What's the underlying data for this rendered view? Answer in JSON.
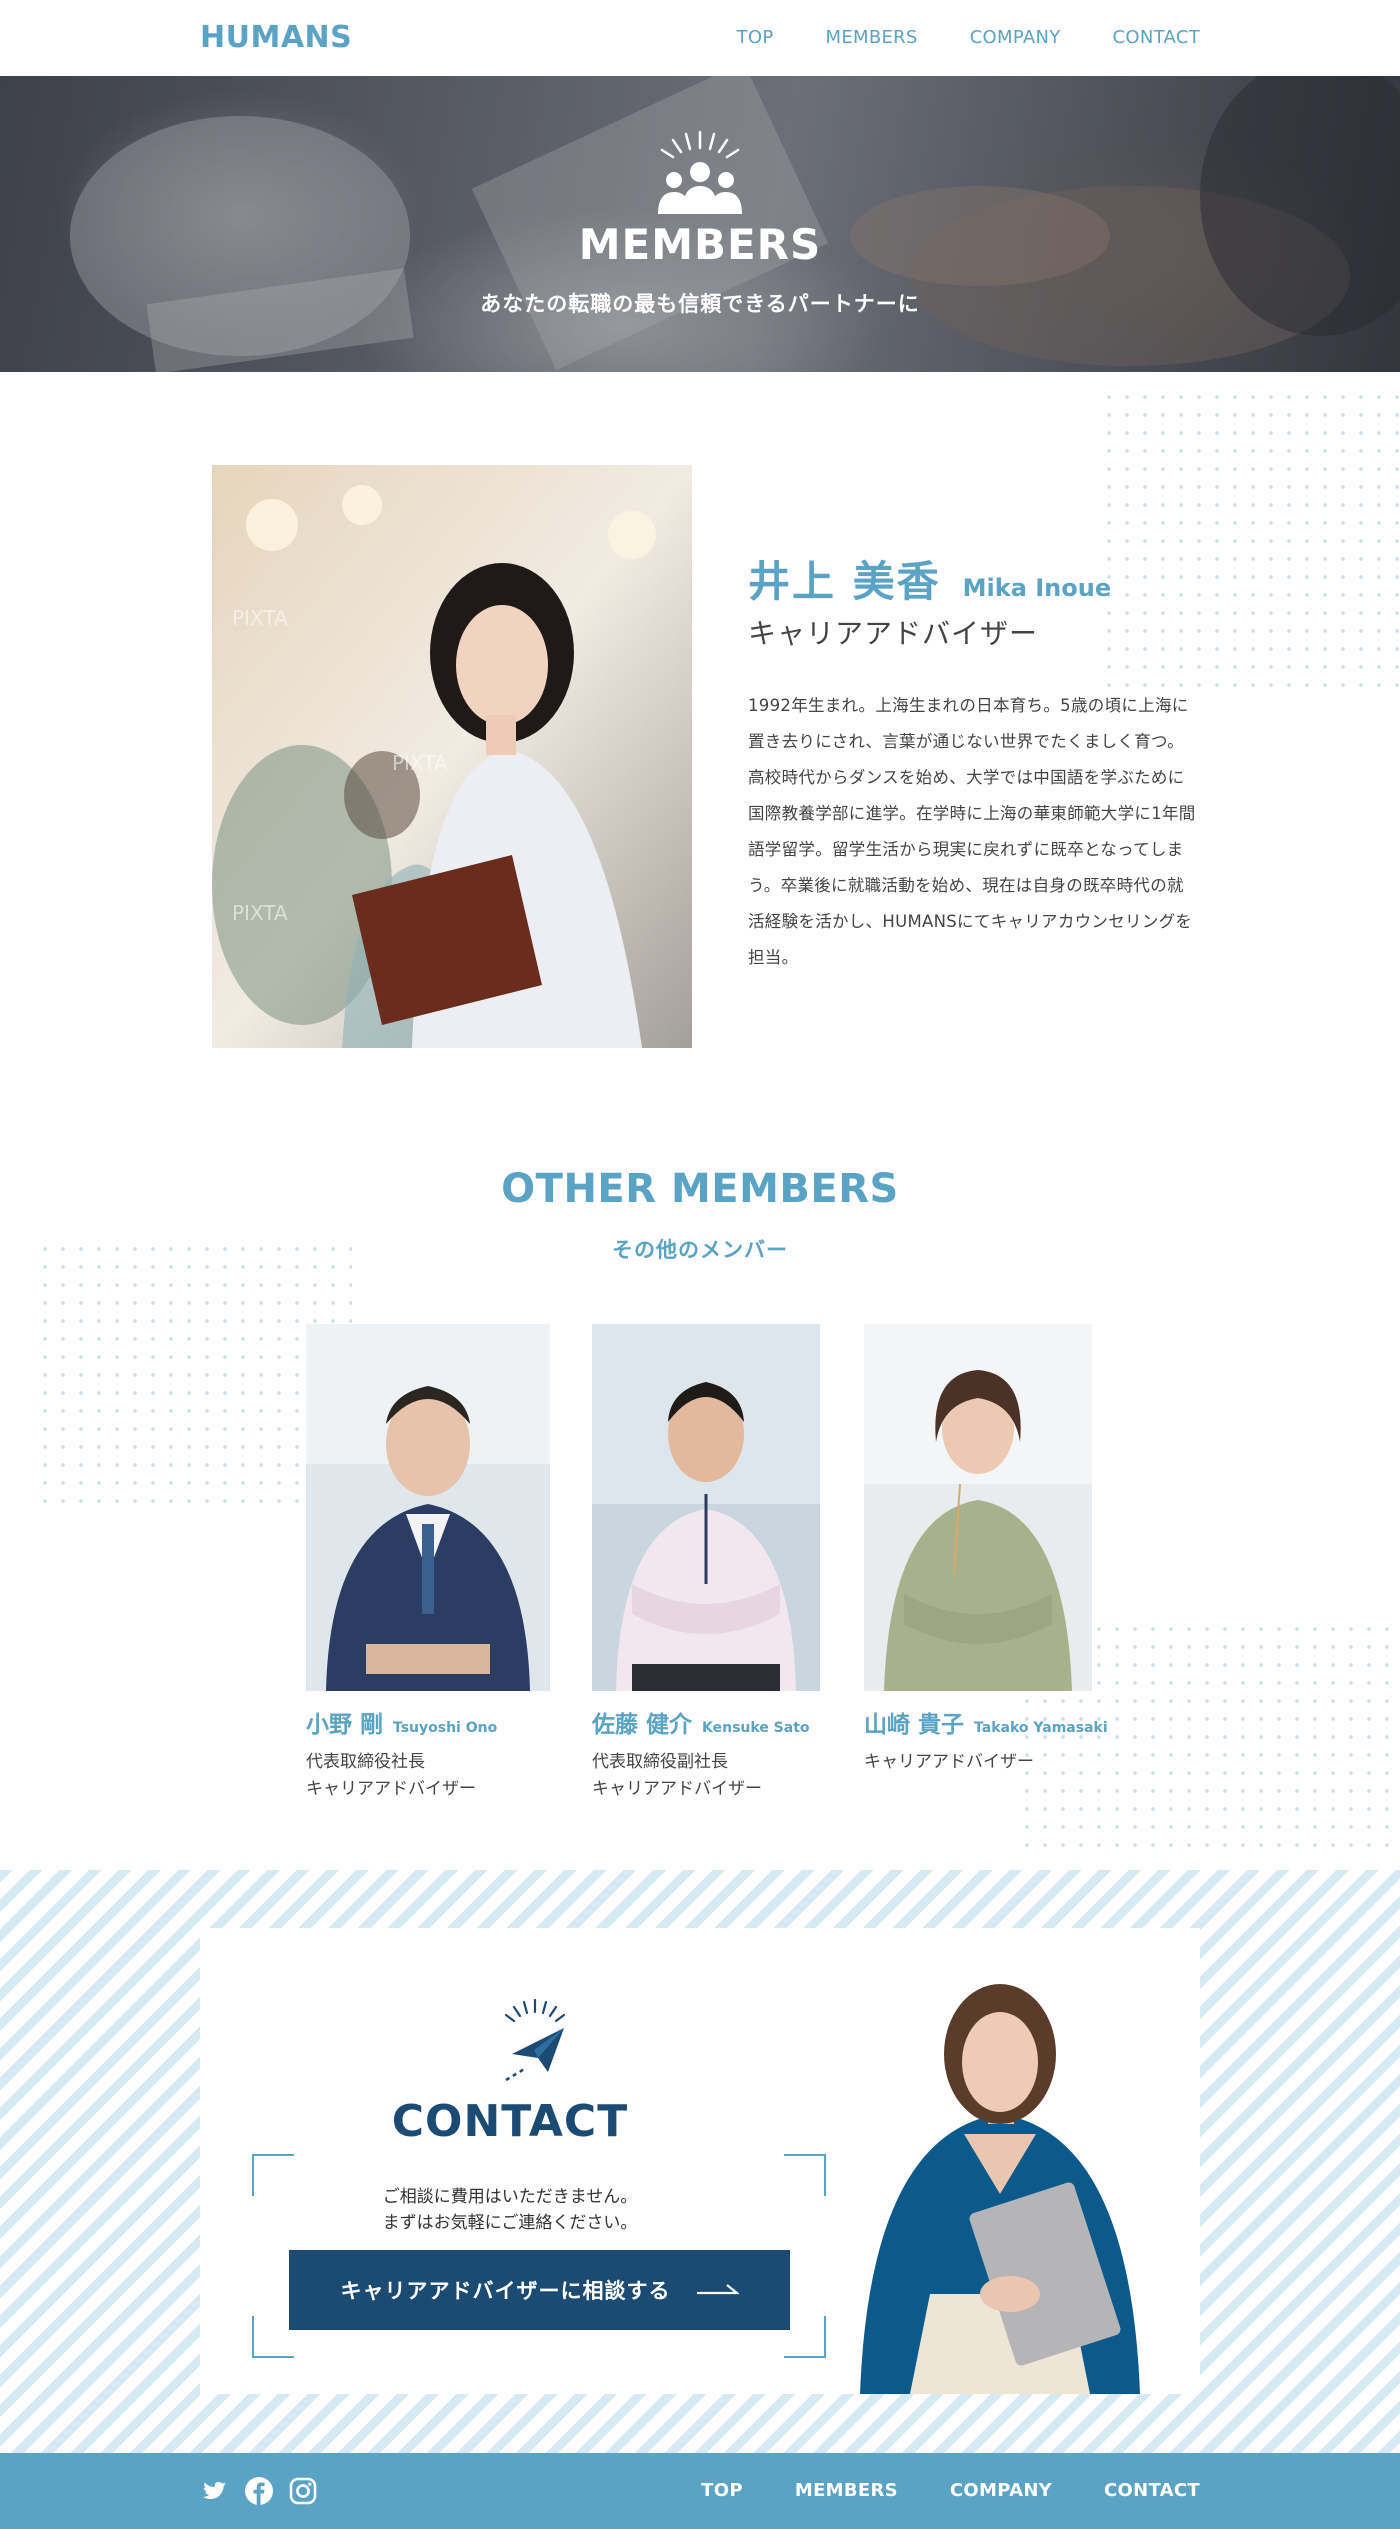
{
  "header": {
    "logo": "HUMANS",
    "nav": [
      "TOP",
      "MEMBERS",
      "COMPANY",
      "CONTACT"
    ]
  },
  "hero": {
    "icon": "team-icon",
    "title": "MEMBERS",
    "subtitle": "あなたの転職の最も信頼できるパートナーに"
  },
  "featured": {
    "name_jp": "井上 美香",
    "name_en": "Mika Inoue",
    "role": "キャリアアドバイザー",
    "bio": "1992年生まれ。上海生まれの日本育ち。5歳の頃に上海に置き去りにされ、言葉が通じない世界でたくましく育つ。高校時代からダンスを始め、大学では中国語を学ぶために国際教養学部に進学。在学時に上海の華東師範大学に1年間語学留学。留学生活から現実に戻れずに既卒となってしまう。卒業後に就職活動を始め、現在は自身の既卒時代の就活経験を活かし、HUMANSにてキャリアカウンセリングを担当。",
    "photo_watermark": "PIXTA"
  },
  "other_members": {
    "title": "OTHER MEMBERS",
    "subtitle": "その他のメンバー",
    "members": [
      {
        "name_jp": "小野 剛",
        "name_en": "Tsuyoshi Ono",
        "roles": [
          "代表取締役社長",
          "キャリアアドバイザー"
        ]
      },
      {
        "name_jp": "佐藤 健介",
        "name_en": "Kensuke Sato",
        "roles": [
          "代表取締役副社長",
          "キャリアアドバイザー"
        ]
      },
      {
        "name_jp": "山崎 貴子",
        "name_en": "Takako Yamasaki",
        "roles": [
          "キャリアアドバイザー"
        ]
      }
    ]
  },
  "contact": {
    "icon": "paper-plane-icon",
    "title": "CONTACT",
    "text_line1": "ご相談に費用はいただきません。",
    "text_line2": "まずはお気軽にご連絡ください。",
    "button_label": "キャリアアドバイザーに相談する"
  },
  "footer": {
    "social": [
      "twitter-icon",
      "facebook-icon",
      "instagram-icon"
    ],
    "nav": [
      "TOP",
      "MEMBERS",
      "COMPANY",
      "CONTACT"
    ]
  },
  "colors": {
    "accent": "#5aa3c4",
    "navy": "#1b4a72",
    "stripe": "#d6eaf3"
  }
}
